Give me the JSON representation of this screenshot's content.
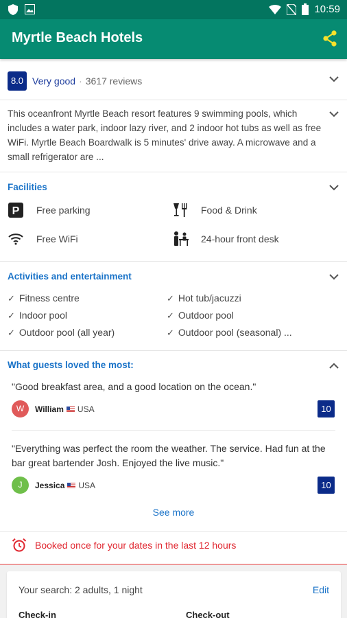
{
  "status_bar": {
    "time": "10:59",
    "icons": [
      "shield-icon",
      "image-icon",
      "wifi-icon",
      "no-sim-icon",
      "battery-icon"
    ]
  },
  "app_bar": {
    "title": "Myrtle Beach Hotels",
    "share_icon": "share-icon"
  },
  "rating": {
    "score": "8.0",
    "label": "Very good",
    "separator": "·",
    "reviews": "3617 reviews"
  },
  "description": "This oceanfront Myrtle Beach resort features 9 swimming pools, which includes a water park, indoor lazy river, and 2 indoor hot tubs as well as free WiFi. Myrtle Beach Boardwalk is 5 minutes' drive away. A microwave and a small refrigerator are ...",
  "facilities": {
    "heading": "Facilities",
    "items": [
      {
        "label": "Free parking",
        "icon": "parking-icon"
      },
      {
        "label": "Food & Drink",
        "icon": "food-drink-icon"
      },
      {
        "label": "Free WiFi",
        "icon": "wifi-icon"
      },
      {
        "label": "24-hour front desk",
        "icon": "front-desk-icon"
      }
    ]
  },
  "activities": {
    "heading": "Activities and entertainment",
    "items": [
      "Fitness centre",
      "Hot tub/jacuzzi",
      "Indoor pool",
      "Outdoor pool",
      "Outdoor pool (all year)",
      "Outdoor pool (seasonal) ..."
    ]
  },
  "guests": {
    "heading": "What guests loved the most:",
    "reviews": [
      {
        "quote": "\"Good breakfast area, and a good location on the ocean.\"",
        "initial": "W",
        "name": "William",
        "country": "USA",
        "score": "10",
        "avatar_color": "#e05a5a"
      },
      {
        "quote": "\"Everything was perfect the room the weather. The service. Had fun at the bar great bartender Josh. Enjoyed the live music.\"",
        "initial": "J",
        "name": "Jessica",
        "country": "USA",
        "score": "10",
        "avatar_color": "#6fbf4a"
      }
    ],
    "see_more": "See more"
  },
  "booking_notice": {
    "text": "Booked once for your dates in the last 12 hours",
    "icon": "alarm-clock-icon"
  },
  "search": {
    "summary": "Your search: 2 adults, 1 night",
    "edit": "Edit",
    "check_in": "Check-in",
    "check_out": "Check-out"
  },
  "colors": {
    "primary": "#068b72",
    "status_bar": "#03755f",
    "link": "#1a73c8",
    "score_badge": "#0b2b89",
    "alert": "#e0262f",
    "share_icon": "#f7e22b"
  }
}
